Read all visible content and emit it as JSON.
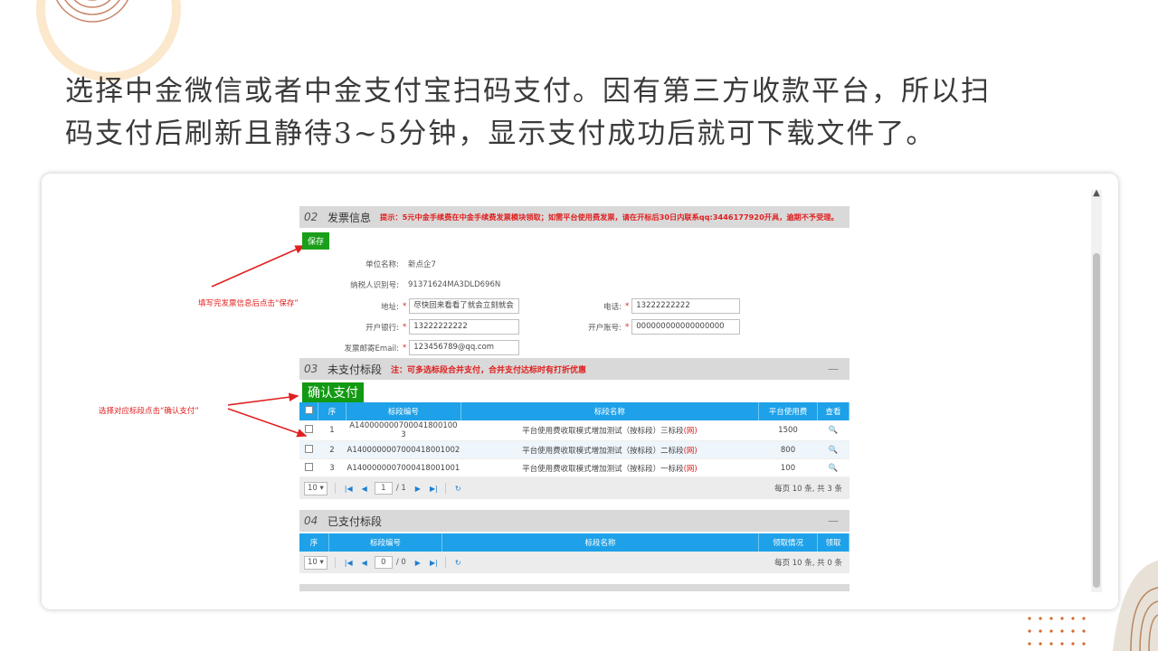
{
  "headline": {
    "line1": "选择中金微信或者中金支付宝扫码支付。因有第三方收款平台，所以扫",
    "line2": "码支付后刷新且静待3~5分钟，显示支付成功后就可下载文件了。"
  },
  "colors": {
    "accent_green": "#1a9f1a",
    "table_header": "#1ea1e8",
    "annotation_red": "#e02020",
    "section_bg": "#d9d9d9"
  },
  "annotations": {
    "save_note": "填写完发票信息后点击“保存”",
    "confirm_note": "选择对应标段点击“确认支付”"
  },
  "invoice": {
    "num": "02",
    "title": "发票信息",
    "tip": "提示：5元中金手续费在中金手续费发票模块领取；如需平台使用费发票，请在开标后30日内联系qq:3446177920开具，逾期不予受理。",
    "save_label": "保存",
    "fields": {
      "unit_label": "单位名称:",
      "unit_value": "新点企7",
      "tax_label": "纳税人识别号:",
      "tax_value": "91371624MA3DLD696N",
      "address_label": "地址:",
      "address_value": "尽快回来看看了就会立刻就会",
      "phone_label": "电话:",
      "phone_value": "13222222222",
      "bank_label": "开户银行:",
      "bank_value": "13222222222",
      "account_label": "开户账号:",
      "account_value": "000000000000000000",
      "email_label": "发票邮寄Email:",
      "email_value": "123456789@qq.com"
    }
  },
  "unpaid": {
    "num": "03",
    "title": "未支付标段",
    "tip": "注：可多选标段合并支付，合并支付达标时有打折优惠",
    "collapse": "—",
    "confirm_label": "确认支付",
    "headers": [
      "序",
      "标段编号",
      "标段名称",
      "平台使用费",
      "查看"
    ],
    "rows": [
      {
        "idx": "1",
        "code": "A140000000700041800100 3",
        "name": "平台使用费收取模式增加测试（按标段）三标段",
        "tag": "(网)",
        "fee": "1500"
      },
      {
        "idx": "2",
        "code": "A1400000007000418001002",
        "name": "平台使用费收取模式增加测试（按标段）二标段",
        "tag": "(网)",
        "fee": "800"
      },
      {
        "idx": "3",
        "code": "A1400000007000418001001",
        "name": "平台使用费收取模式增加测试（按标段）一标段",
        "tag": "(网)",
        "fee": "100"
      }
    ],
    "pager": {
      "size": "10",
      "page": "1",
      "total_pages": "/ 1",
      "info": "每页 10 条, 共 3 条"
    }
  },
  "paid": {
    "num": "04",
    "title": "已支付标段",
    "collapse": "—",
    "headers": [
      "序",
      "标段编号",
      "标段名称",
      "领取情况",
      "领取"
    ],
    "pager": {
      "size": "10",
      "page": "0",
      "total_pages": "/ 0",
      "info": "每页 10 条, 共 0 条"
    }
  }
}
